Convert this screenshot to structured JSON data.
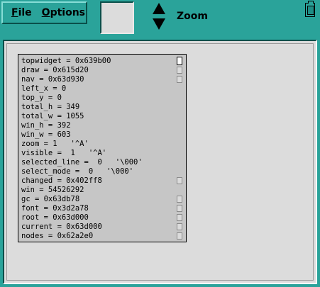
{
  "menubar": {
    "file": {
      "mnemonic": "F",
      "rest": "ile"
    },
    "options": {
      "mnemonic": "O",
      "rest": "ptions"
    }
  },
  "zoom": {
    "label": "Zoom"
  },
  "variables": [
    {
      "text": "topwidget = 0x639b00",
      "mark": "big"
    },
    {
      "text": "draw = 0x615d20",
      "mark": "small"
    },
    {
      "text": "nav = 0x63d930",
      "mark": "small"
    },
    {
      "text": "left_x = 0",
      "mark": ""
    },
    {
      "text": "top_y = 0",
      "mark": ""
    },
    {
      "text": "total_h = 349",
      "mark": ""
    },
    {
      "text": "total_w = 1055",
      "mark": ""
    },
    {
      "text": "win_h = 392",
      "mark": ""
    },
    {
      "text": "win_w = 603",
      "mark": ""
    },
    {
      "text": "zoom = 1   '^A'",
      "mark": ""
    },
    {
      "text": "visible =  1   '^A'",
      "mark": ""
    },
    {
      "text": "selected_line =  0   '\\000'",
      "mark": ""
    },
    {
      "text": "select_mode =  0   '\\000'",
      "mark": ""
    },
    {
      "text": "changed = 0x402ff8",
      "mark": "small"
    },
    {
      "text": "win = 54526292",
      "mark": ""
    },
    {
      "text": "gc = 0x63db78",
      "mark": "small"
    },
    {
      "text": "font = 0x3d2a78",
      "mark": "small"
    },
    {
      "text": "root = 0x63d000",
      "mark": "small"
    },
    {
      "text": "current = 0x63d000",
      "mark": "small"
    },
    {
      "text": "nodes = 0x62a2e0",
      "mark": "small"
    }
  ]
}
